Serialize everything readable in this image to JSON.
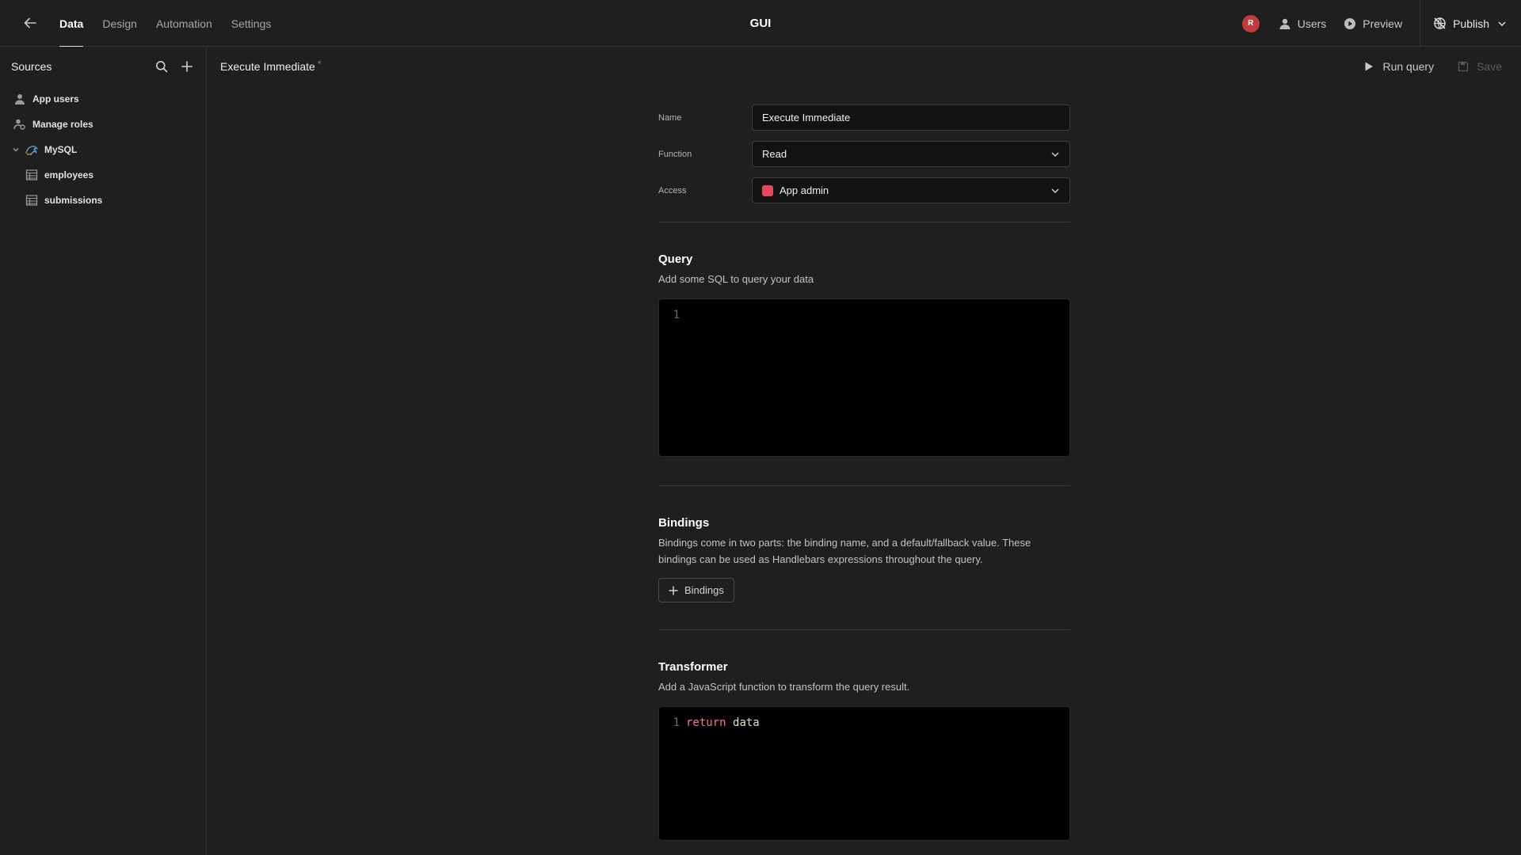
{
  "topbar": {
    "tabs": [
      {
        "label": "Data",
        "active": true
      },
      {
        "label": "Design",
        "active": false
      },
      {
        "label": "Automation",
        "active": false
      },
      {
        "label": "Settings",
        "active": false
      }
    ],
    "app_title": "GUI",
    "avatar_initial": "R",
    "users_label": "Users",
    "preview_label": "Preview",
    "publish_label": "Publish"
  },
  "sidebar": {
    "title": "Sources",
    "items": [
      {
        "label": "App users",
        "icon": "user-icon"
      },
      {
        "label": "Manage roles",
        "icon": "roles-icon"
      },
      {
        "label": "MySQL",
        "icon": "mysql-icon",
        "expanded": true
      },
      {
        "label": "employees",
        "icon": "table-icon"
      },
      {
        "label": "submissions",
        "icon": "table-icon"
      }
    ]
  },
  "content_header": {
    "title": "Execute Immediate",
    "unsaved_marker": "*",
    "run_label": "Run query",
    "save_label": "Save"
  },
  "form": {
    "name_label": "Name",
    "name_value": "Execute Immediate",
    "function_label": "Function",
    "function_value": "Read",
    "access_label": "Access",
    "access_value": "App admin",
    "access_color": "#e5485c"
  },
  "query": {
    "title": "Query",
    "description": "Add some SQL to query your data",
    "line_number": "1"
  },
  "bindings": {
    "title": "Bindings",
    "description": "Bindings come in two parts: the binding name, and a default/fallback value. These bindings can be used as Handlebars expressions throughout the query.",
    "button_label": "Bindings"
  },
  "transformer": {
    "title": "Transformer",
    "description": "Add a JavaScript function to transform the query result.",
    "line_number": "1",
    "code_keyword": "return",
    "code_var": "data"
  }
}
